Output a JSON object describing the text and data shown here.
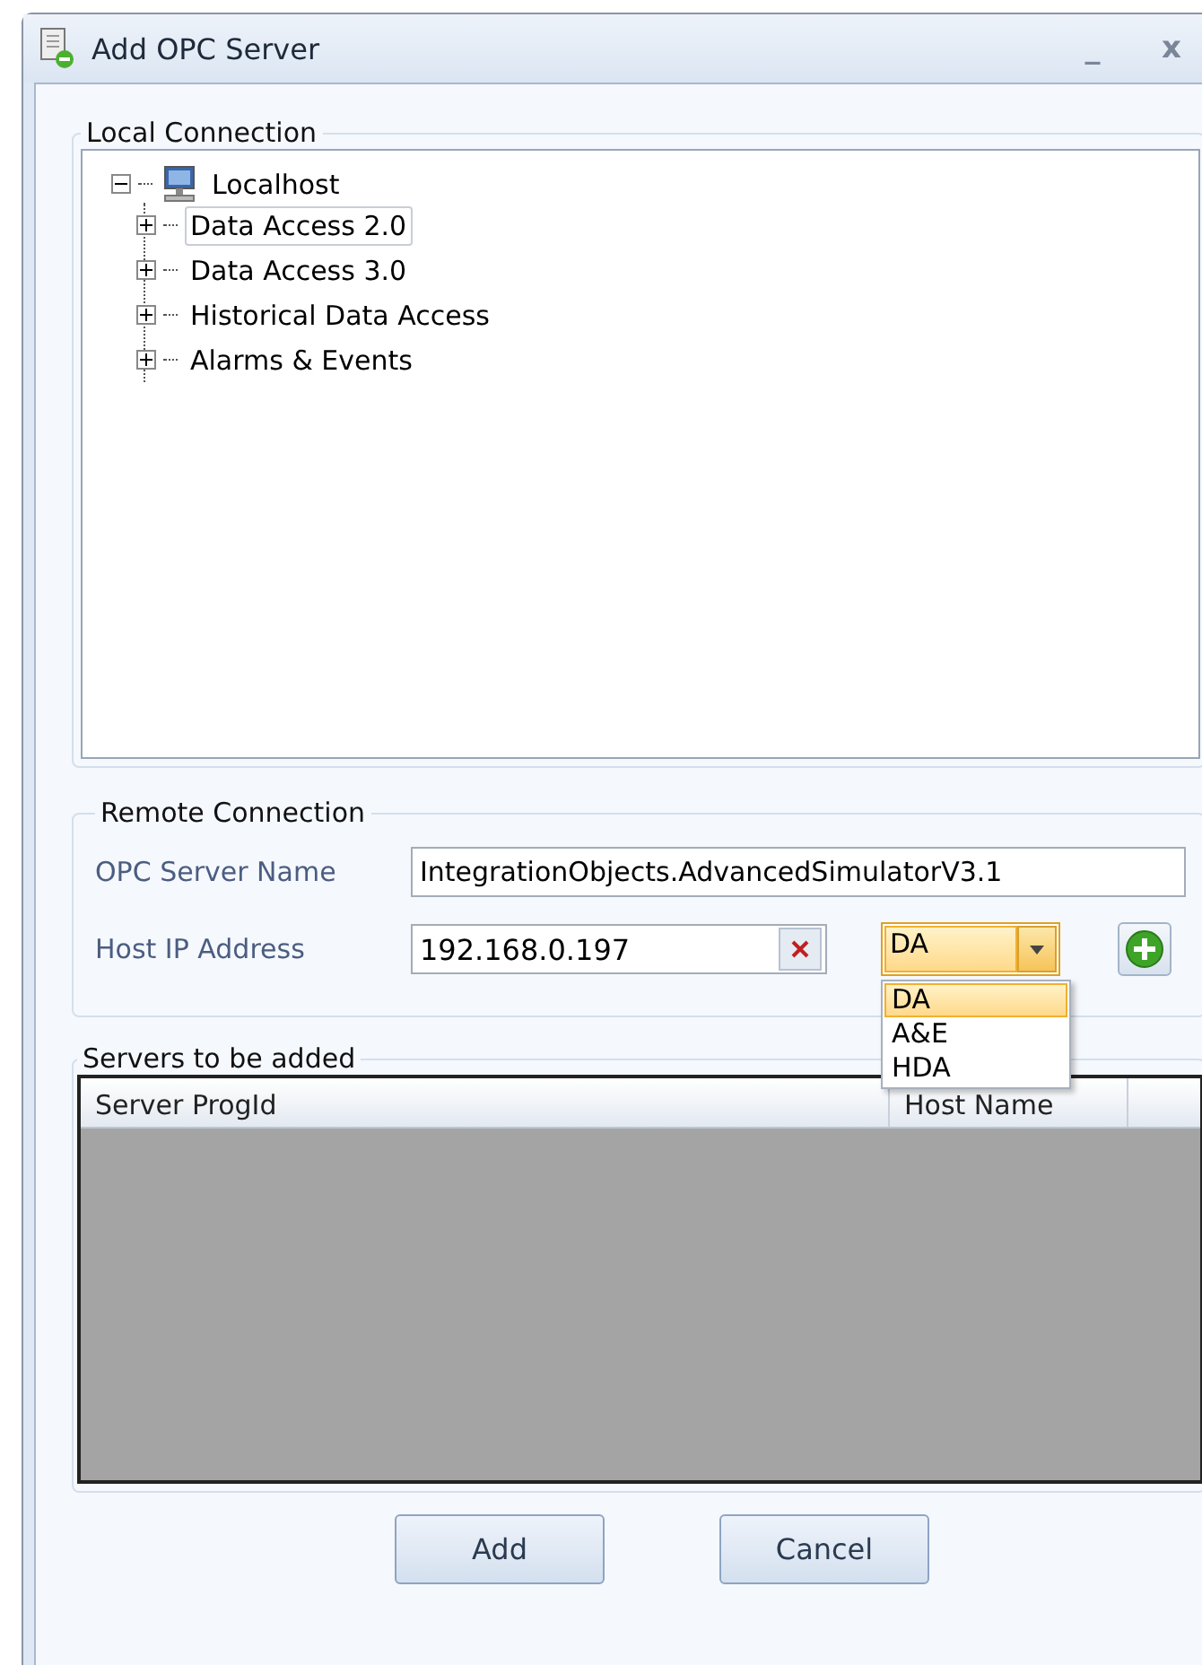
{
  "window": {
    "title": "Add OPC Server",
    "controls": [
      "_",
      "x"
    ]
  },
  "local_connection": {
    "title": "Local Connection",
    "tree": [
      {
        "label": "Localhost",
        "expanded": true,
        "selected": false,
        "children": [
          {
            "label": "Data Access 2.0",
            "expanded": false,
            "selected": true
          },
          {
            "label": "Data Access 3.0",
            "expanded": false,
            "selected": false
          },
          {
            "label": "Historical Data Access",
            "expanded": false,
            "selected": false
          },
          {
            "label": "Alarms & Events",
            "expanded": false,
            "selected": false
          }
        ]
      }
    ]
  },
  "remote_connection": {
    "title": "Remote Connection",
    "server_name": {
      "label": "OPC Server Name",
      "value": "IntegrationObjects.AdvancedSimulatorV3.1"
    },
    "host_ip": {
      "label": "Host IP Address",
      "value": "192.168.0.197"
    },
    "type_combo": {
      "value": "DA",
      "expanded": true,
      "options": [
        {
          "label": "DA",
          "selected": true
        },
        {
          "label": "A&E",
          "selected": false
        },
        {
          "label": "HDA",
          "selected": false
        }
      ]
    }
  },
  "servers": {
    "title": "Servers to be added",
    "columns": [
      "Server ProgId",
      "Host Name"
    ]
  },
  "buttons": [
    "Add",
    "Cancel"
  ]
}
